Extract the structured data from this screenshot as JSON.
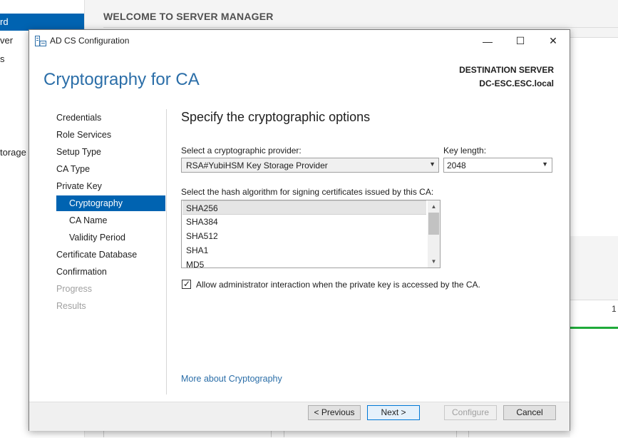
{
  "background": {
    "sidebar": {
      "items": [
        "rd",
        "ver",
        "s",
        "torage"
      ]
    },
    "header": {
      "welcome": "WELCOME TO SERVER MANAGER"
    },
    "right_panel_tick": "1"
  },
  "window": {
    "title": "AD CS Configuration",
    "controls": {
      "minimize": "—",
      "maximize": "☐",
      "close": "✕"
    }
  },
  "page": {
    "title": "Cryptography for CA",
    "destination_label": "DESTINATION SERVER",
    "destination_server": "DC-ESC.ESC.local"
  },
  "nav": {
    "items": [
      {
        "label": "Credentials",
        "state": "normal"
      },
      {
        "label": "Role Services",
        "state": "normal"
      },
      {
        "label": "Setup Type",
        "state": "normal"
      },
      {
        "label": "CA Type",
        "state": "normal"
      },
      {
        "label": "Private Key",
        "state": "normal"
      },
      {
        "label": "Cryptography",
        "state": "active"
      },
      {
        "label": "CA Name",
        "state": "sub"
      },
      {
        "label": "Validity Period",
        "state": "sub"
      },
      {
        "label": "Certificate Database",
        "state": "normal"
      },
      {
        "label": "Confirmation",
        "state": "normal"
      },
      {
        "label": "Progress",
        "state": "disabled"
      },
      {
        "label": "Results",
        "state": "disabled"
      }
    ]
  },
  "content": {
    "heading": "Specify the cryptographic options",
    "provider": {
      "label": "Select a cryptographic provider:",
      "value": "RSA#YubiHSM Key Storage Provider"
    },
    "key_length": {
      "label": "Key length:",
      "value": "2048"
    },
    "hash": {
      "label": "Select the hash algorithm for signing certificates issued by this CA:",
      "items": [
        "SHA256",
        "SHA384",
        "SHA512",
        "SHA1",
        "MD5"
      ],
      "selected": "SHA256"
    },
    "admin_interaction": {
      "label": "Allow administrator interaction when the private key is accessed by the CA.",
      "checked": true
    },
    "more_link": "More about Cryptography"
  },
  "footer": {
    "previous": "< Previous",
    "next": "Next >",
    "configure": "Configure",
    "cancel": "Cancel"
  },
  "colors": {
    "accent": "#0063b1",
    "title_blue": "#2b6ea8",
    "progress_green": "#1faa3a"
  }
}
